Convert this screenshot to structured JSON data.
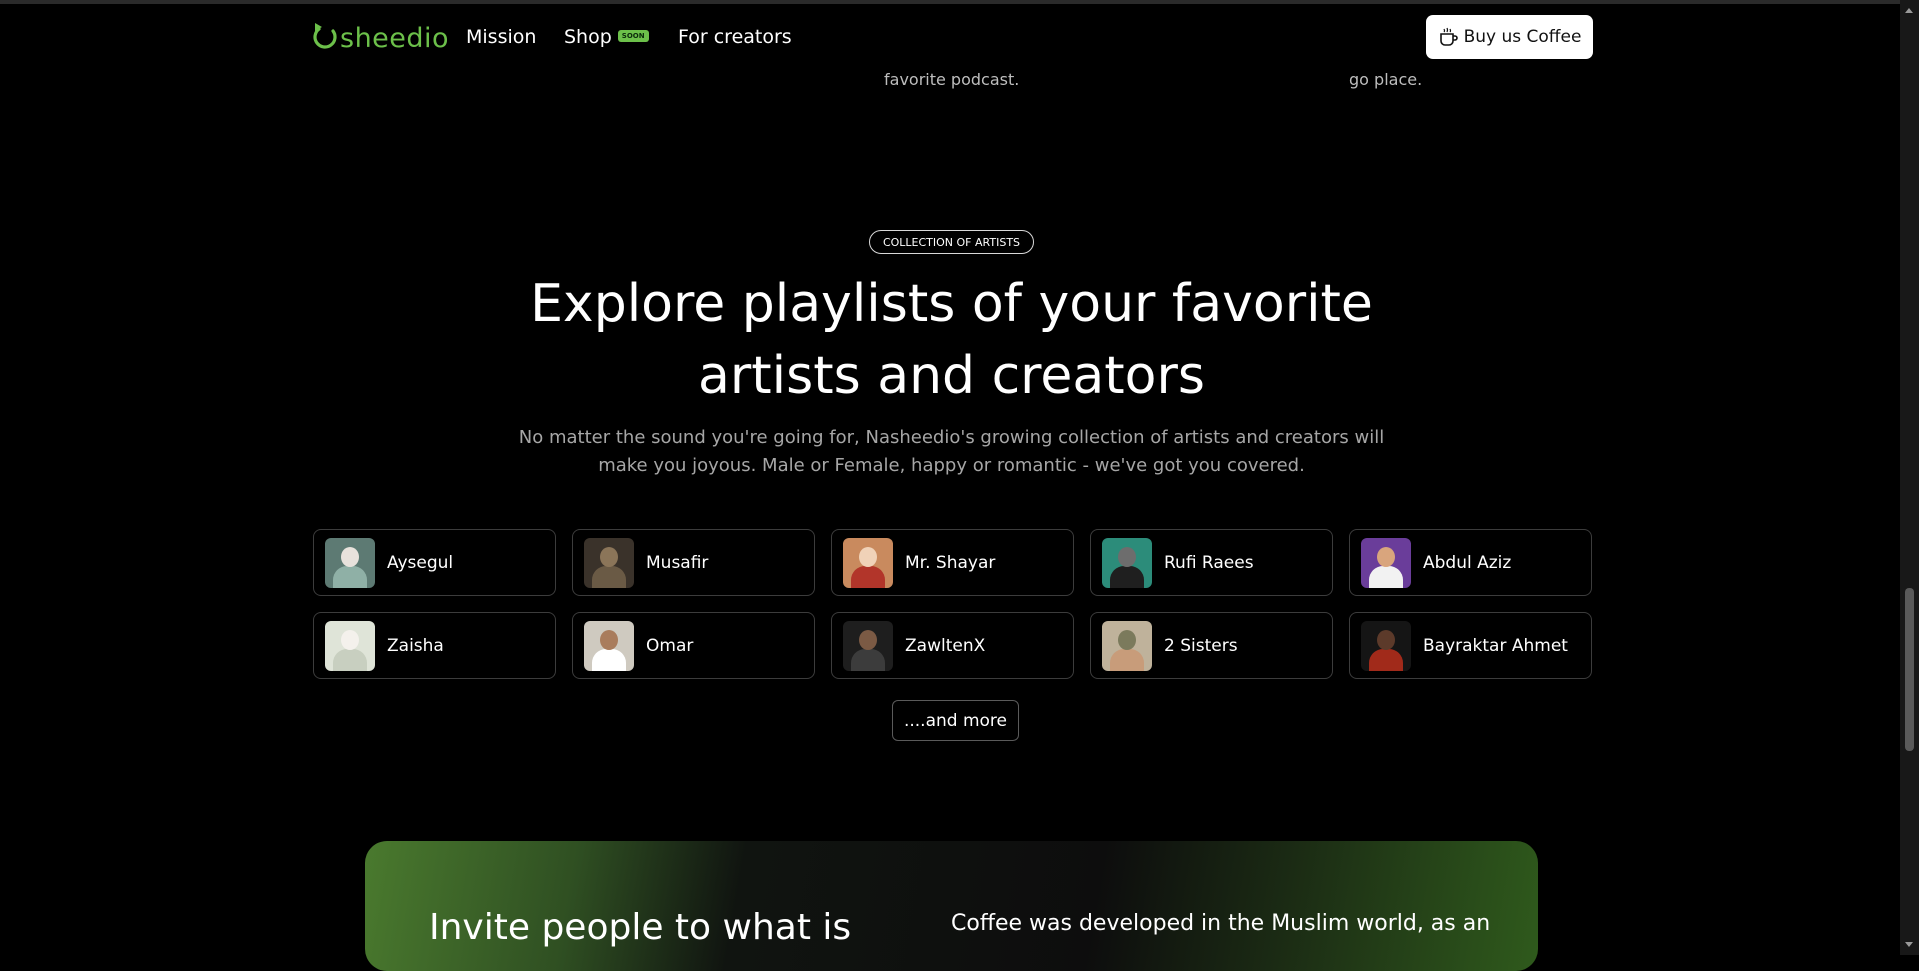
{
  "nav": {
    "logo_text": "sheedio",
    "links": [
      {
        "label": "Mission"
      },
      {
        "label": "Shop",
        "badge": "SOON"
      },
      {
        "label": "For creators"
      }
    ],
    "cta_label": "Buy us Coffee",
    "brand_color": "#6cc04a"
  },
  "previous_section": {
    "fragment_1": "favorite podcast.",
    "fragment_2": "go place."
  },
  "artists_section": {
    "badge": "COLLECTION OF ARTISTS",
    "headline": "Explore playlists of your favorite artists and creators",
    "subtext": "No matter the sound you're going for, Nasheedio's growing collection of artists and creators will make you joyous. Male or Female, happy or romantic - we've got you covered.",
    "artists": [
      {
        "name": "Aysegul",
        "avatar_colors": [
          "#5d7a73",
          "#e8e2dc",
          "#8fb0a6"
        ]
      },
      {
        "name": "Musafir",
        "avatar_colors": [
          "#3a322a",
          "#8b7559",
          "#6a5a45"
        ]
      },
      {
        "name": "Mr. Shayar",
        "avatar_colors": [
          "#c98a5e",
          "#f0d2b8",
          "#b2352a"
        ]
      },
      {
        "name": "Rufi Raees",
        "avatar_colors": [
          "#2c8c7a",
          "#6d6d6d",
          "#1f1f1f"
        ]
      },
      {
        "name": "Abdul Aziz",
        "avatar_colors": [
          "#6a3d9a",
          "#d9a57d",
          "#f2f2f2"
        ]
      },
      {
        "name": "Zaisha",
        "avatar_colors": [
          "#dfe4d8",
          "#f4f1ec",
          "#c8cfc0"
        ]
      },
      {
        "name": "Omar",
        "avatar_colors": [
          "#cfcac0",
          "#a97c5c",
          "#ffffff"
        ]
      },
      {
        "name": "ZawltenX",
        "avatar_colors": [
          "#1e1e1e",
          "#7b5a44",
          "#3c3c3c"
        ]
      },
      {
        "name": "2 Sisters",
        "avatar_colors": [
          "#bfb29b",
          "#7b7a5c",
          "#c89c7a"
        ]
      },
      {
        "name": "Bayraktar Ahmet",
        "avatar_colors": [
          "#151515",
          "#5c3a2a",
          "#a12a1a"
        ]
      }
    ],
    "more_label": "....and more"
  },
  "invite_section": {
    "left_text": "Invite people to what is",
    "right_text": "Coffee was developed in the Muslim world, as an"
  }
}
